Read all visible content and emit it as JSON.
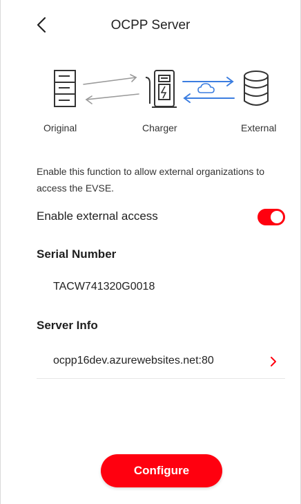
{
  "header": {
    "title": "OCPP Server",
    "back_icon": "chevron-left-icon"
  },
  "diagram": {
    "labels": {
      "original": "Original",
      "charger": "Charger",
      "external": "External"
    },
    "icons": [
      "server-rack-icon",
      "arrows-gray-icon",
      "ev-charger-icon",
      "arrows-cloud-blue-icon",
      "database-icon"
    ],
    "colors": {
      "gray_arrows": "#9a9a9a",
      "blue_arrows": "#3b7de0"
    }
  },
  "description": "Enable this function to allow external organizations to access the EVSE.",
  "external_access": {
    "label": "Enable external access",
    "enabled": true
  },
  "serial": {
    "title": "Serial Number",
    "value": "TACW741320G0018"
  },
  "server_info": {
    "title": "Server Info",
    "value": "ocpp16dev.azurewebsites.net:80"
  },
  "actions": {
    "configure_label": "Configure"
  },
  "colors": {
    "accent": "#ff000f",
    "text": "#1f1f1f"
  }
}
